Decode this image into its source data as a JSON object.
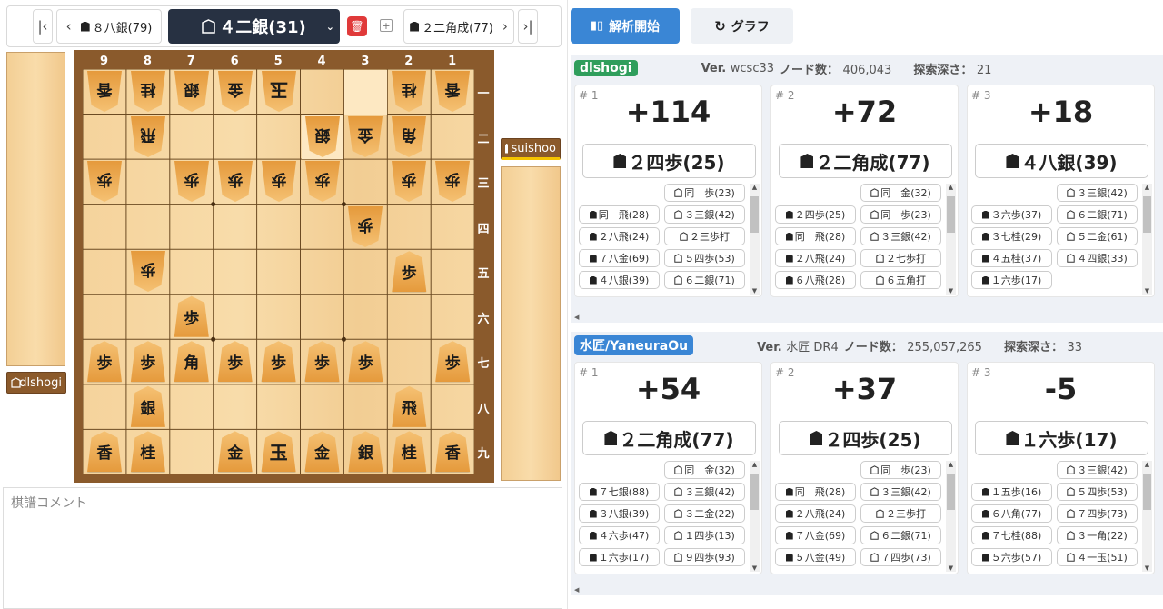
{
  "nav": {
    "prev_move": "８八銀(79)",
    "current_move": "４二銀(31)",
    "next_move": "２二角成(77)"
  },
  "players": {
    "gote": "dlshogi",
    "sente": "suishoo"
  },
  "board": {
    "files": [
      "9",
      "8",
      "7",
      "6",
      "5",
      "4",
      "3",
      "2",
      "1"
    ],
    "ranks": [
      "一",
      "二",
      "三",
      "四",
      "五",
      "六",
      "七",
      "八",
      "九"
    ]
  },
  "comment": {
    "placeholder": "棋譜コメント"
  },
  "toolbar": {
    "analyze_label": "解析開始",
    "graph_label": "グラフ"
  },
  "engines": [
    {
      "name": "dlshogi",
      "color": "#2f9e5c",
      "ver_label": "Ver.",
      "version": "wcsc33",
      "nodes_label": "ノード数：",
      "nodes": "406,043",
      "depth_label": "探索深さ：",
      "depth": "21",
      "cands": [
        {
          "rank": "# 1",
          "score": "+114",
          "best": "２四歩(25)",
          "best_side": "sente",
          "pv": [
            [
              "",
              "",
              "gote",
              "同　歩(23)"
            ],
            [
              "sente",
              "同　飛(28)",
              "gote",
              "３三銀(42)"
            ],
            [
              "sente",
              "２八飛(24)",
              "gote",
              "２三歩打"
            ],
            [
              "sente",
              "７八金(69)",
              "gote",
              "５四歩(53)"
            ],
            [
              "sente",
              "４八銀(39)",
              "gote",
              "６二銀(71)"
            ]
          ]
        },
        {
          "rank": "# 2",
          "score": "+72",
          "best": "２二角成(77)",
          "best_side": "sente",
          "pv": [
            [
              "",
              "",
              "gote",
              "同　金(32)"
            ],
            [
              "sente",
              "２四歩(25)",
              "gote",
              "同　歩(23)"
            ],
            [
              "sente",
              "同　飛(28)",
              "gote",
              "３三銀(42)"
            ],
            [
              "sente",
              "２八飛(24)",
              "gote",
              "２七歩打"
            ],
            [
              "sente",
              "６八飛(28)",
              "gote",
              "６五角打"
            ]
          ]
        },
        {
          "rank": "# 3",
          "score": "+18",
          "best": "４八銀(39)",
          "best_side": "sente",
          "pv": [
            [
              "",
              "",
              "gote",
              "３三銀(42)"
            ],
            [
              "sente",
              "３六歩(37)",
              "gote",
              "６二銀(71)"
            ],
            [
              "sente",
              "３七桂(29)",
              "gote",
              "５二金(61)"
            ],
            [
              "sente",
              "４五桂(37)",
              "gote",
              "４四銀(33)"
            ],
            [
              "sente",
              "１六歩(17)",
              "",
              ""
            ]
          ]
        }
      ]
    },
    {
      "name": "水匠/YaneuraOu",
      "color": "#3a86d5",
      "ver_label": "Ver.",
      "version": "水匠 DR4",
      "nodes_label": "ノード数：",
      "nodes": "255,057,265",
      "depth_label": "探索深さ：",
      "depth": "33",
      "cands": [
        {
          "rank": "# 1",
          "score": "+54",
          "best": "２二角成(77)",
          "best_side": "sente",
          "pv": [
            [
              "",
              "",
              "gote",
              "同　金(32)"
            ],
            [
              "sente",
              "７七銀(88)",
              "gote",
              "３三銀(42)"
            ],
            [
              "sente",
              "３八銀(39)",
              "gote",
              "３二金(22)"
            ],
            [
              "sente",
              "４六歩(47)",
              "gote",
              "１四歩(13)"
            ],
            [
              "sente",
              "１六歩(17)",
              "gote",
              "９四歩(93)"
            ]
          ]
        },
        {
          "rank": "# 2",
          "score": "+37",
          "best": "２四歩(25)",
          "best_side": "sente",
          "pv": [
            [
              "",
              "",
              "gote",
              "同　歩(23)"
            ],
            [
              "sente",
              "同　飛(28)",
              "gote",
              "３三銀(42)"
            ],
            [
              "sente",
              "２八飛(24)",
              "gote",
              "２三歩打"
            ],
            [
              "sente",
              "７八金(69)",
              "gote",
              "６二銀(71)"
            ],
            [
              "sente",
              "５八金(49)",
              "gote",
              "７四歩(73)"
            ]
          ]
        },
        {
          "rank": "# 3",
          "score": "-5",
          "best": "１六歩(17)",
          "best_side": "sente",
          "pv": [
            [
              "",
              "",
              "gote",
              "３三銀(42)"
            ],
            [
              "sente",
              "１五歩(16)",
              "gote",
              "５四歩(53)"
            ],
            [
              "sente",
              "６八角(77)",
              "gote",
              "７四歩(73)"
            ],
            [
              "sente",
              "７七桂(88)",
              "gote",
              "３一角(22)"
            ],
            [
              "sente",
              "５六歩(57)",
              "gote",
              "４一玉(51)"
            ]
          ]
        }
      ]
    }
  ],
  "pieces": [
    {
      "file": 9,
      "rank": 1,
      "kanji": "香",
      "side": "gote"
    },
    {
      "file": 8,
      "rank": 1,
      "kanji": "桂",
      "side": "gote"
    },
    {
      "file": 7,
      "rank": 1,
      "kanji": "銀",
      "side": "gote"
    },
    {
      "file": 6,
      "rank": 1,
      "kanji": "金",
      "side": "gote"
    },
    {
      "file": 5,
      "rank": 1,
      "kanji": "玉",
      "side": "gote"
    },
    {
      "file": 2,
      "rank": 1,
      "kanji": "桂",
      "side": "gote"
    },
    {
      "file": 1,
      "rank": 1,
      "kanji": "香",
      "side": "gote"
    },
    {
      "file": 8,
      "rank": 2,
      "kanji": "飛",
      "side": "gote"
    },
    {
      "file": 4,
      "rank": 2,
      "kanji": "銀",
      "side": "gote"
    },
    {
      "file": 3,
      "rank": 2,
      "kanji": "金",
      "side": "gote"
    },
    {
      "file": 2,
      "rank": 2,
      "kanji": "角",
      "side": "gote"
    },
    {
      "file": 9,
      "rank": 3,
      "kanji": "歩",
      "side": "gote"
    },
    {
      "file": 7,
      "rank": 3,
      "kanji": "歩",
      "side": "gote"
    },
    {
      "file": 6,
      "rank": 3,
      "kanji": "歩",
      "side": "gote"
    },
    {
      "file": 5,
      "rank": 3,
      "kanji": "歩",
      "side": "gote"
    },
    {
      "file": 4,
      "rank": 3,
      "kanji": "歩",
      "side": "gote"
    },
    {
      "file": 2,
      "rank": 3,
      "kanji": "歩",
      "side": "gote"
    },
    {
      "file": 1,
      "rank": 3,
      "kanji": "歩",
      "side": "gote"
    },
    {
      "file": 3,
      "rank": 4,
      "kanji": "歩",
      "side": "gote"
    },
    {
      "file": 8,
      "rank": 5,
      "kanji": "歩",
      "side": "gote"
    },
    {
      "file": 2,
      "rank": 5,
      "kanji": "歩",
      "side": "sente"
    },
    {
      "file": 7,
      "rank": 6,
      "kanji": "歩",
      "side": "sente"
    },
    {
      "file": 9,
      "rank": 7,
      "kanji": "歩",
      "side": "sente"
    },
    {
      "file": 8,
      "rank": 7,
      "kanji": "歩",
      "side": "sente"
    },
    {
      "file": 7,
      "rank": 7,
      "kanji": "角",
      "side": "sente"
    },
    {
      "file": 6,
      "rank": 7,
      "kanji": "歩",
      "side": "sente"
    },
    {
      "file": 5,
      "rank": 7,
      "kanji": "歩",
      "side": "sente"
    },
    {
      "file": 4,
      "rank": 7,
      "kanji": "歩",
      "side": "sente"
    },
    {
      "file": 3,
      "rank": 7,
      "kanji": "歩",
      "side": "sente"
    },
    {
      "file": 1,
      "rank": 7,
      "kanji": "歩",
      "side": "sente"
    },
    {
      "file": 8,
      "rank": 8,
      "kanji": "銀",
      "side": "sente"
    },
    {
      "file": 2,
      "rank": 8,
      "kanji": "飛",
      "side": "sente"
    },
    {
      "file": 9,
      "rank": 9,
      "kanji": "香",
      "side": "sente"
    },
    {
      "file": 8,
      "rank": 9,
      "kanji": "桂",
      "side": "sente"
    },
    {
      "file": 6,
      "rank": 9,
      "kanji": "金",
      "side": "sente"
    },
    {
      "file": 5,
      "rank": 9,
      "kanji": "玉",
      "side": "sente"
    },
    {
      "file": 4,
      "rank": 9,
      "kanji": "金",
      "side": "sente"
    },
    {
      "file": 3,
      "rank": 9,
      "kanji": "銀",
      "side": "sente"
    },
    {
      "file": 2,
      "rank": 9,
      "kanji": "桂",
      "side": "sente"
    },
    {
      "file": 1,
      "rank": 9,
      "kanji": "香",
      "side": "sente"
    }
  ],
  "highlights": [
    {
      "file": 3,
      "rank": 1
    },
    {
      "file": 4,
      "rank": 2
    }
  ]
}
